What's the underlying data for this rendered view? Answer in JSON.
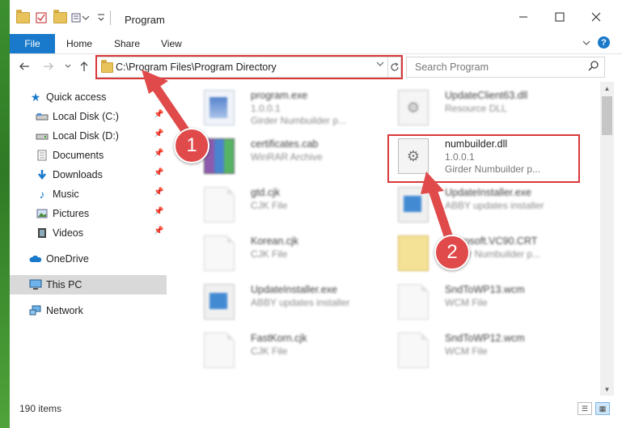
{
  "window": {
    "title": "Program"
  },
  "ribbon": {
    "tabs": [
      "File",
      "Home",
      "Share",
      "View"
    ]
  },
  "address": {
    "path": "C:\\Program Files\\Program Directory"
  },
  "search": {
    "placeholder": "Search Program"
  },
  "nav": {
    "quick_access": "Quick access",
    "pinned": [
      {
        "label": "Local Disk (C:)",
        "icon": "drive-icon"
      },
      {
        "label": "Local Disk (D:)",
        "icon": "drive-icon"
      },
      {
        "label": "Documents",
        "icon": "documents-icon"
      },
      {
        "label": "Downloads",
        "icon": "downloads-icon"
      },
      {
        "label": "Music",
        "icon": "music-icon"
      },
      {
        "label": "Pictures",
        "icon": "pictures-icon"
      },
      {
        "label": "Videos",
        "icon": "videos-icon"
      }
    ],
    "onedrive": "OneDrive",
    "this_pc": "This PC",
    "network": "Network"
  },
  "files": [
    {
      "name": "program.exe",
      "line1": "1.0.0.1",
      "line2": "Girder Numbuilder p...",
      "icon": "exe-icon"
    },
    {
      "name": "UpdateClient63.dll",
      "line1": "Resource DLL",
      "line2": "",
      "icon": "dll-icon"
    },
    {
      "name": "certificates.cab",
      "line1": "WinRAR Archive",
      "line2": "",
      "icon": "winrar-icon"
    },
    {
      "name": "numbuilder.dll",
      "line1": "1.0.0.1",
      "line2": "Girder Numbuilder p...",
      "icon": "dll-icon"
    },
    {
      "name": "gtd.cjk",
      "line1": "CJK File",
      "line2": "",
      "icon": "file-icon"
    },
    {
      "name": "UpdateInstaller.exe",
      "line1": "ABBY updates installer",
      "line2": "",
      "icon": "installer-icon"
    },
    {
      "name": "Korean.cjk",
      "line1": "CJK File",
      "line2": "",
      "icon": "file-icon"
    },
    {
      "name": "Microsoft.VC90.CRT",
      "line1": "Girder Numbuilder p...",
      "line2": "",
      "icon": "folder-icon"
    },
    {
      "name": "UpdateInstaller.exe",
      "line1": "ABBY updates installer",
      "line2": "",
      "icon": "installer-icon"
    },
    {
      "name": "SndToWP13.wcm",
      "line1": "WCM File",
      "line2": "",
      "icon": "file-icon"
    },
    {
      "name": "FastKorn.cjk",
      "line1": "CJK File",
      "line2": "",
      "icon": "file-icon"
    },
    {
      "name": "SndToWP12.wcm",
      "line1": "WCM File",
      "line2": "",
      "icon": "file-icon"
    }
  ],
  "status": {
    "items": "190 items"
  },
  "annotations": {
    "step1": "1",
    "step2": "2"
  },
  "colors": {
    "accent": "#1979ca",
    "highlight": "#d9393a"
  }
}
